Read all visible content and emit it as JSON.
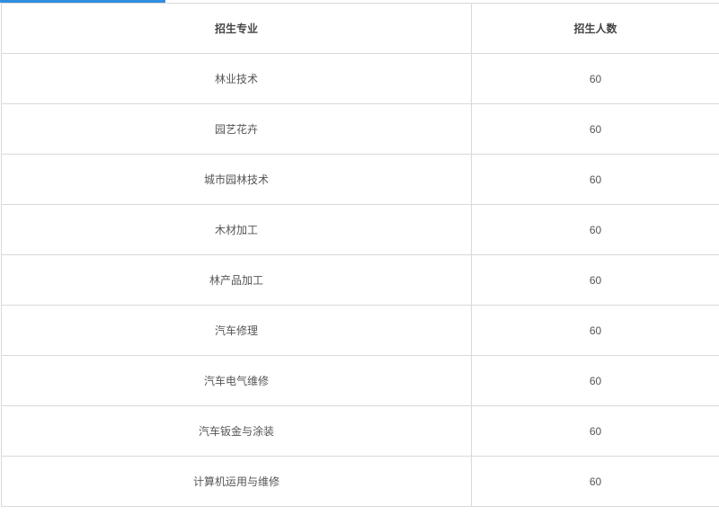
{
  "table": {
    "headers": [
      "招生专业",
      "招生人数"
    ],
    "rows": [
      {
        "major": "林业技术",
        "count": "60"
      },
      {
        "major": "园艺花卉",
        "count": "60"
      },
      {
        "major": "城市园林技术",
        "count": "60"
      },
      {
        "major": "木材加工",
        "count": "60"
      },
      {
        "major": "林产品加工",
        "count": "60"
      },
      {
        "major": "汽车修理",
        "count": "60"
      },
      {
        "major": "汽车电气维修",
        "count": "60"
      },
      {
        "major": "汽车钣金与涂装",
        "count": "60"
      },
      {
        "major": "计算机运用与维修",
        "count": "60"
      }
    ]
  },
  "colors": {
    "accent": "#2f8fe0",
    "border": "#d9d9d9",
    "text": "#555555"
  }
}
